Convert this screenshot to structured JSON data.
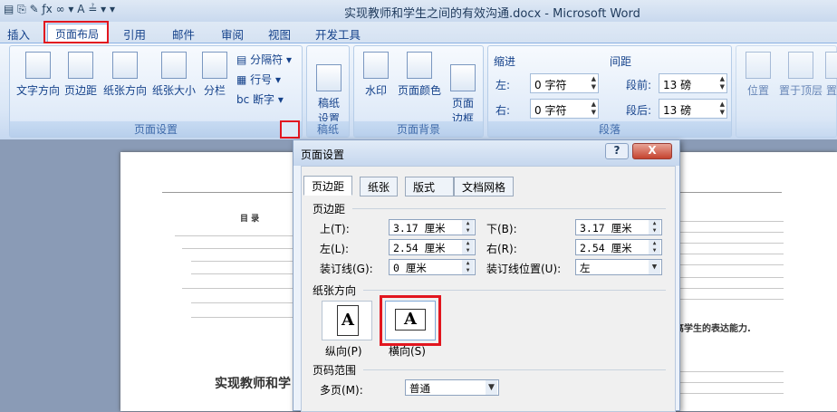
{
  "window": {
    "title": "实现教师和学生之间的有效沟通.docx - Microsoft Word"
  },
  "tabs": [
    "插入",
    "页面布局",
    "引用",
    "邮件",
    "审阅",
    "视图",
    "开发工具"
  ],
  "ribbon": {
    "page_setup": {
      "label": "页面设置",
      "buttons": [
        "文字方向",
        "页边距",
        "纸张方向",
        "纸张大小",
        "分栏"
      ],
      "small": [
        "分隔符",
        "行号",
        "断字"
      ]
    },
    "manuscript": {
      "label": "稿纸",
      "button": "稿纸\n设置"
    },
    "background": {
      "label": "页面背景",
      "buttons": [
        "水印",
        "页面颜色",
        "页面\n边框"
      ]
    },
    "paragraph": {
      "label": "段落",
      "indent_title": "缩进",
      "spacing_title": "间距",
      "left_label": "左:",
      "left_value": "0 字符",
      "right_label": "右:",
      "right_value": "0 字符",
      "before_label": "段前:",
      "before_value": "13 磅",
      "after_label": "段后:",
      "after_value": "13 磅"
    },
    "arrange": {
      "buttons": [
        "位置",
        "置于顶层",
        "置"
      ]
    }
  },
  "document": {
    "toc_title": "目  录",
    "heading": "实现教师和学",
    "right_heading": "高学生的表达能力."
  },
  "dialog": {
    "title": "页面设置",
    "help": "?",
    "close": "X",
    "tabs": [
      "页边距",
      "纸张",
      "版式",
      "文档网格"
    ],
    "margins_section": "页边距",
    "top_label": "上(T):",
    "top_value": "3.17 厘米",
    "bottom_label": "下(B):",
    "bottom_value": "3.17 厘米",
    "left_label": "左(L):",
    "left_value": "2.54 厘米",
    "right_label": "右(R):",
    "right_value": "2.54 厘米",
    "gutter_label": "装订线(G):",
    "gutter_value": "0 厘米",
    "gutter_pos_label": "装订线位置(U):",
    "gutter_pos_value": "左",
    "orientation_section": "纸张方向",
    "portrait": "纵向(P)",
    "landscape": "横向(S)",
    "pages_section": "页码范围",
    "multi_label": "多页(M):",
    "multi_value": "普通"
  }
}
